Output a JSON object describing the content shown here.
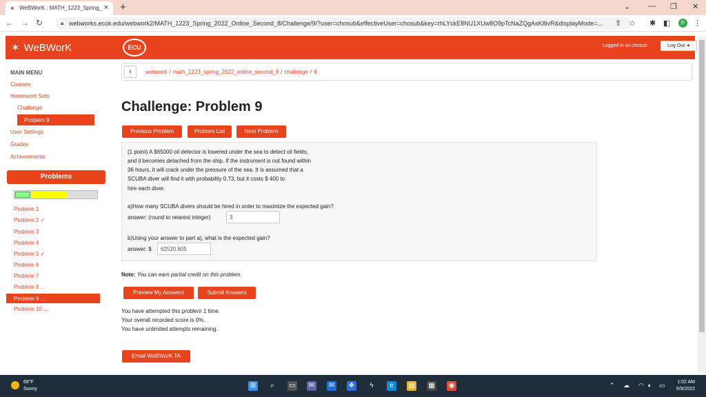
{
  "browser": {
    "tab_title": "WeBWorK : MATH_1223_Spring_",
    "url": "webworks.ecok.edu/webwork2/MATH_1223_Spring_2022_Online_Second_8/Challenge/9/?user=chosub&effectiveUser=chosub&key=rhLYckE8NU1XUw8O9pTcNaZQgAsK8ivR&displayMode=...",
    "profile_initial": "P"
  },
  "header": {
    "logo": "WeBWorK",
    "ecu_badge": "ECU",
    "logged_in": "Logged in as chosub",
    "logout_label": "Log Out"
  },
  "sidebar": {
    "menu_title": "MAIN MENU",
    "courses": "Courses",
    "homework_sets": "Homework Sets",
    "challenge": "Challenge",
    "active_problem": "Problem 9",
    "user_settings": "User Settings",
    "grades": "Grades",
    "achievements": "Achievements",
    "problems_header": "Problems",
    "progress": {
      "correct_fraction": 0.18,
      "attempted_fraction": 0.44
    },
    "problem_links": [
      "Problem 1",
      "Problem 2 ✓",
      "Problem 3",
      "Problem 4",
      "Problem 5 ✓",
      "Problem 6",
      "Problem 7",
      "Problem 8 ...",
      "Problem 9 ...",
      "Problem 10 ..."
    ]
  },
  "breadcrumb": {
    "items": [
      "webwork",
      "math_1223_spring_2022_online_second_8",
      "challenge",
      "9"
    ]
  },
  "main": {
    "title": "Challenge: Problem 9",
    "prev_btn": "Previous Problem",
    "list_btn": "Problem List",
    "next_btn": "Next Problem",
    "problem_lines": [
      "(1 point) A $65000 oil detector is lowered under the sea to detect oil fields,",
      "and it becomes detached from the ship. If the instrument is not found within",
      "36 hours, it will crack under the pressure of the sea. It is assumed that a",
      "SCUBA diver will find it with probability 0.73, but it costs $ 400 to",
      "hire each diver."
    ],
    "part_a_question": "a)How many SCUBA divers should be hired in order to maximize the expected gain?",
    "part_a_label": "answer: (round to nearest integer)",
    "part_a_value": "3",
    "part_b_question": "b)Using your answer to part a), what is the expected gain?",
    "part_b_label": "answer: $",
    "part_b_value": "62520.605",
    "note_label": "Note:",
    "note_text": "You can earn partial credit on this problem.",
    "preview_btn": "Preview My Answers",
    "submit_btn": "Submit Answers",
    "attempts": [
      "You have attempted this problem 1 time.",
      "Your overall recorded score is 0%.",
      "You have unlimited attempts remaining."
    ],
    "email_btn": "Email WeBWorK TA"
  },
  "taskbar": {
    "temp": "68°F",
    "weather": "Sunny",
    "time": "1:02 AM",
    "date": "5/9/2022"
  },
  "colors": {
    "brand": "#e9431e",
    "taskbar": "#1f2c3a"
  }
}
